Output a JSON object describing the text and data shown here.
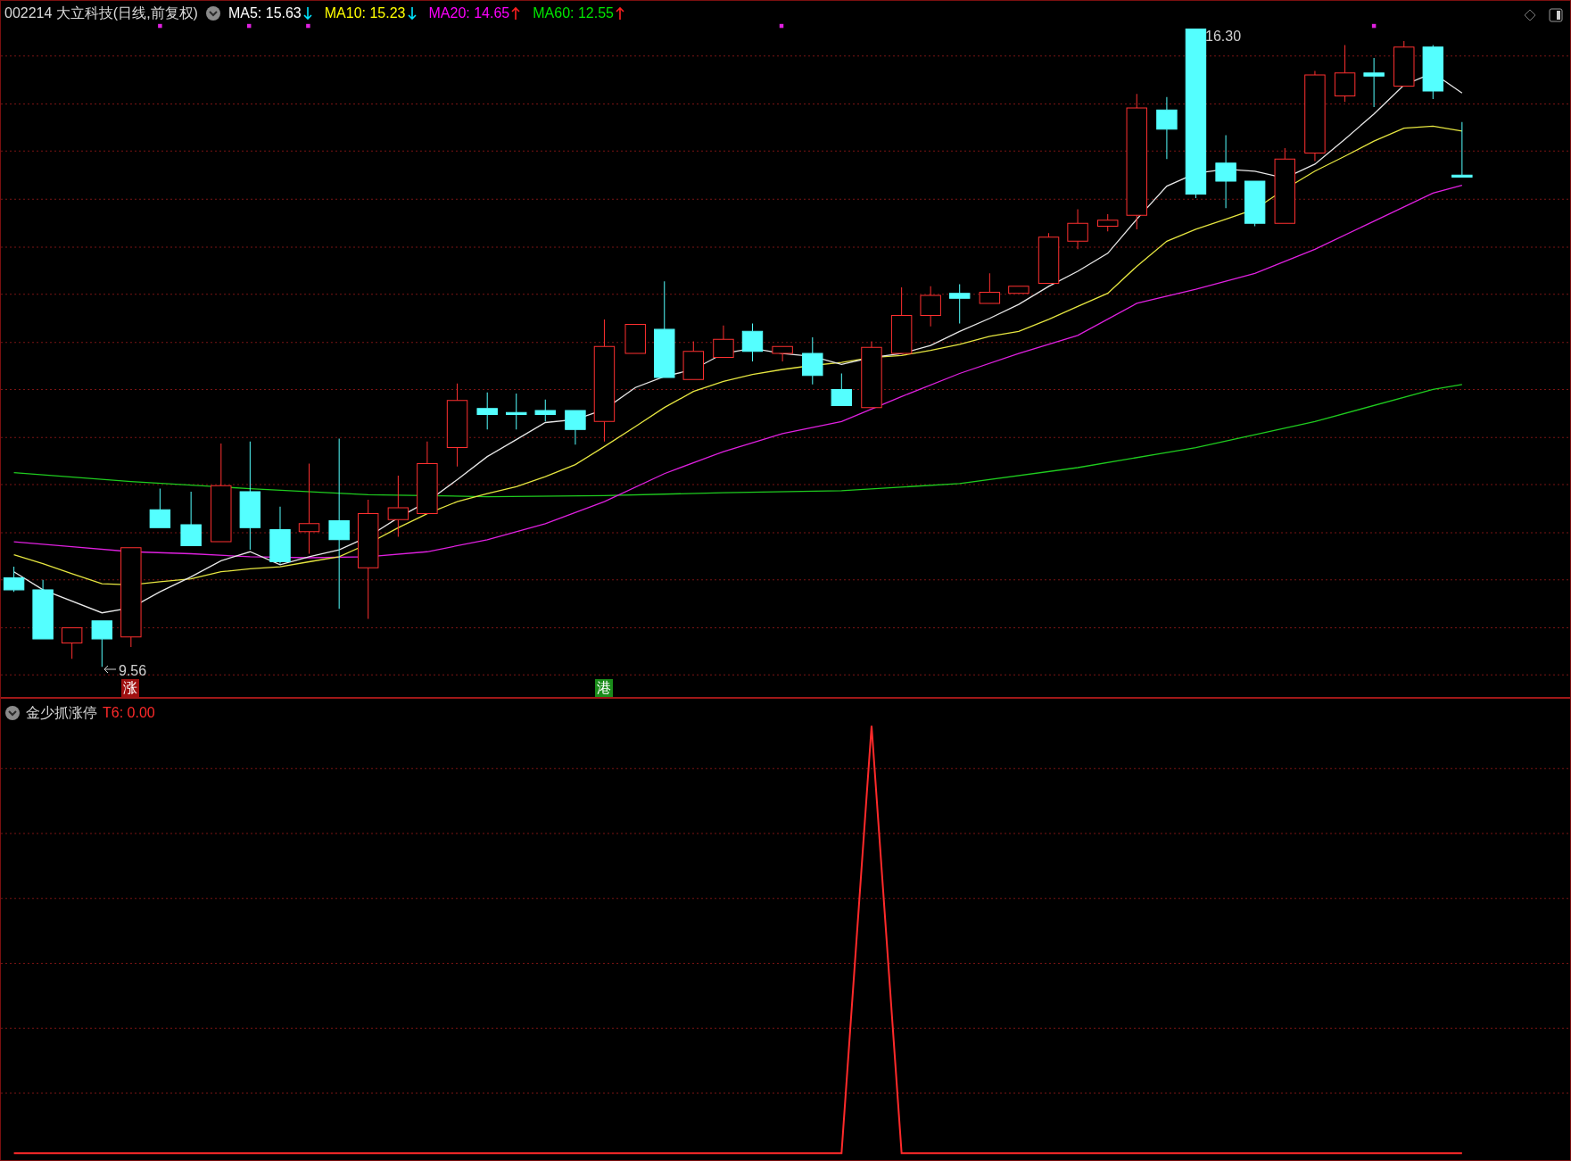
{
  "header": {
    "title": "002214 大立科技(日线,前复权)",
    "indicators": [
      {
        "label": "MA5: 15.63",
        "color": "#ffffff",
        "rising": false
      },
      {
        "label": "MA10: 15.23",
        "color": "#ffff00",
        "rising": false
      },
      {
        "label": "MA20: 14.65",
        "color": "#ff00ff",
        "rising": true
      },
      {
        "label": "MA60: 12.55",
        "color": "#00e600",
        "rising": true
      }
    ]
  },
  "price_labels": {
    "high": "16.30",
    "low": "9.56"
  },
  "signals": [
    {
      "text": "涨",
      "color": "#a01010"
    },
    {
      "text": "港",
      "color": "#1a8c1a"
    }
  ],
  "indicator_panel": {
    "name": "金少抓涨停",
    "reading": "T6: 0.00"
  }
}
